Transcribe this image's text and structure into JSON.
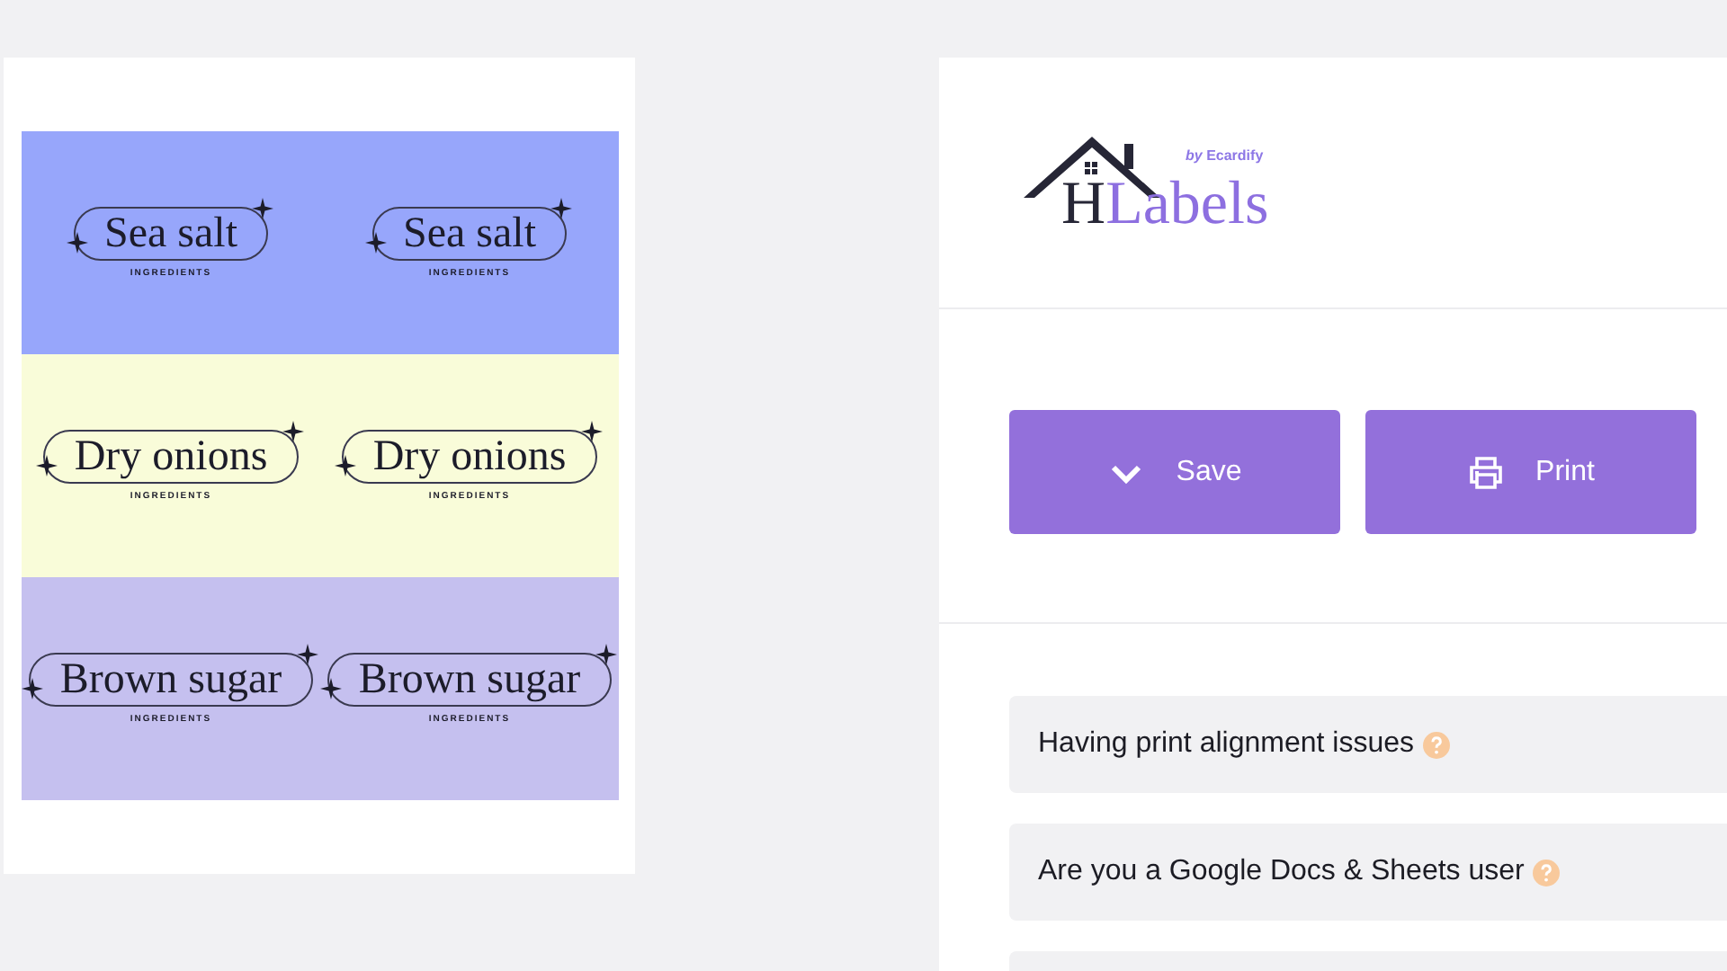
{
  "sheet": {
    "labels": [
      {
        "name": "Sea salt",
        "subtitle": "INGREDIENTS",
        "color": "#97a6fb"
      },
      {
        "name": "Sea salt",
        "subtitle": "INGREDIENTS",
        "color": "#97a6fb"
      },
      {
        "name": "Dry onions",
        "subtitle": "INGREDIENTS",
        "color": "#f9fcd9"
      },
      {
        "name": "Dry onions",
        "subtitle": "INGREDIENTS",
        "color": "#f9fcd9"
      },
      {
        "name": "Brown sugar",
        "subtitle": "INGREDIENTS",
        "color": "#c5c0ef"
      },
      {
        "name": "Brown sugar",
        "subtitle": "INGREDIENTS",
        "color": "#c5c0ef"
      }
    ]
  },
  "logo": {
    "text": "HLabels",
    "tagline": "*by* Ecardify"
  },
  "actions": [
    {
      "label": "Save",
      "kind": "save"
    },
    {
      "label": "Print",
      "kind": "print"
    }
  ],
  "help_items": [
    {
      "text": "Having print alignment issues"
    },
    {
      "text": "Are you a Google Docs & Sheets user"
    }
  ]
}
